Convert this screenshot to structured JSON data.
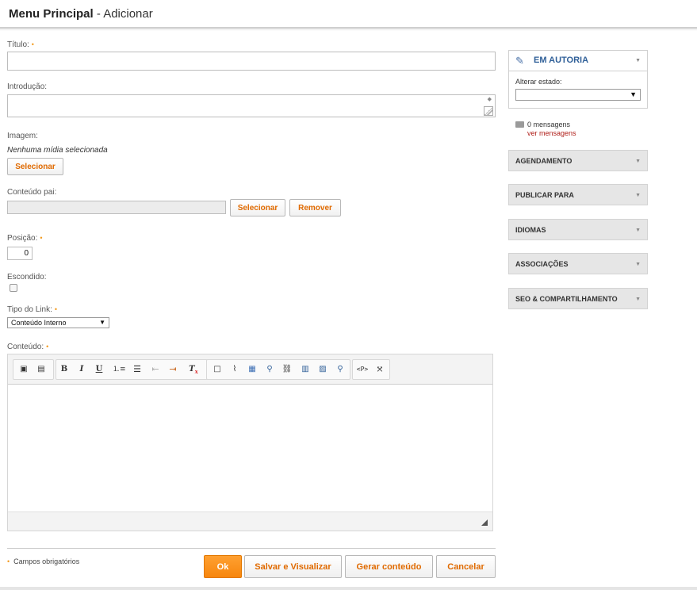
{
  "header": {
    "title": "Menu Principal",
    "subtitle": "- Adicionar"
  },
  "form": {
    "titulo_label": "Título:",
    "introducao_label": "Introdução:",
    "imagem_label": "Imagem:",
    "imagem_status": "Nenhuma mídia selecionada",
    "imagem_button": "Selecionar",
    "conteudo_pai_label": "Conteúdo pai:",
    "conteudo_pai_select": "Selecionar",
    "conteudo_pai_remove": "Remover",
    "posicao_label": "Posição:",
    "posicao_value": "0",
    "escondido_label": "Escondido:",
    "tipo_link_label": "Tipo do Link:",
    "tipo_link_value": "Conteúdo Interno",
    "conteudo_label": "Conteúdo:",
    "required_mark": "•"
  },
  "footer": {
    "required_note": "Campos obrigatórios",
    "buttons": {
      "ok": "Ok",
      "save_view": "Salvar e Visualizar",
      "generate": "Gerar conteúdo",
      "cancel": "Cancelar"
    }
  },
  "sidebar": {
    "status_title": "EM AUTORIA",
    "change_state_label": "Alterar estado:",
    "messages_count": "0 mensagens",
    "messages_link": "ver mensagens",
    "sections": [
      "AGENDAMENTO",
      "PUBLICAR PARA",
      "IDIOMAS",
      "ASSOCIAÇÕES",
      "SEO & COMPARTILHAMENTO"
    ]
  },
  "colors": {
    "accent": "#f7860d",
    "link": "#e06a00",
    "status_title": "#2f5f98"
  }
}
